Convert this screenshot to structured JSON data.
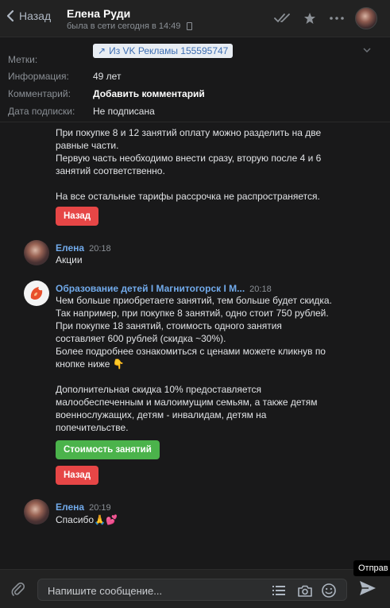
{
  "header": {
    "back_label": "Назад",
    "title": "Елена Руди",
    "status": "была в сети сегодня в 14:49"
  },
  "info": {
    "tag_chip": "Из VK Рекламы 155595747",
    "rows": [
      {
        "label": "Метки:",
        "value": ""
      },
      {
        "label": "Информация:",
        "value": "49 лет"
      },
      {
        "label": "Комментарий:",
        "value": "Добавить комментарий"
      },
      {
        "label": "Дата подписки:",
        "value": "Не подписана"
      }
    ]
  },
  "messages": {
    "m1": {
      "lines": [
        "При покупке 8 и 12 занятий оплату можно разделить на две",
        "равные части.",
        "Первую часть необходимо внести сразу, вторую после 4 и 6",
        "занятий соответственно.",
        "",
        "На все остальные тарифы рассрочка не распространяется."
      ],
      "button": "Назад"
    },
    "m2": {
      "sender": "Елена",
      "time": "20:18",
      "text": "Акции"
    },
    "m3": {
      "sender": "Образование детей I Магнитогорск I М...",
      "time": "20:18",
      "lines": [
        "Чем больше приобретаете занятий, тем больше будет скидка.",
        "Так например, при покупке 8 занятий, одно стоит 750 рублей.",
        "При покупке 18 занятий, стоимость одного занятия",
        "составляет 600 рублей (скидка ~30%).",
        "Более подробнее ознакомиться с ценами можете кликнув по",
        "кнопке ниже 👇",
        "",
        "Дополнительная скидка 10% предоставляется",
        "малообеспеченным и малоимущим семьям, а также детям",
        "военнослужащих, детям - инвалидам, детям на",
        "попечительстве."
      ],
      "button_green": "Стоимость занятий",
      "button_red": "Назад"
    },
    "m4": {
      "sender": "Елена",
      "time": "20:19",
      "text": "Спасибо🙏💕"
    }
  },
  "composer": {
    "placeholder": "Напишите сообщение...",
    "send_tooltip": "Отправ"
  },
  "colors": {
    "background": "#19191a",
    "link": "#71aaeb",
    "red_button": "#e64646",
    "green_button": "#4bb34b"
  }
}
